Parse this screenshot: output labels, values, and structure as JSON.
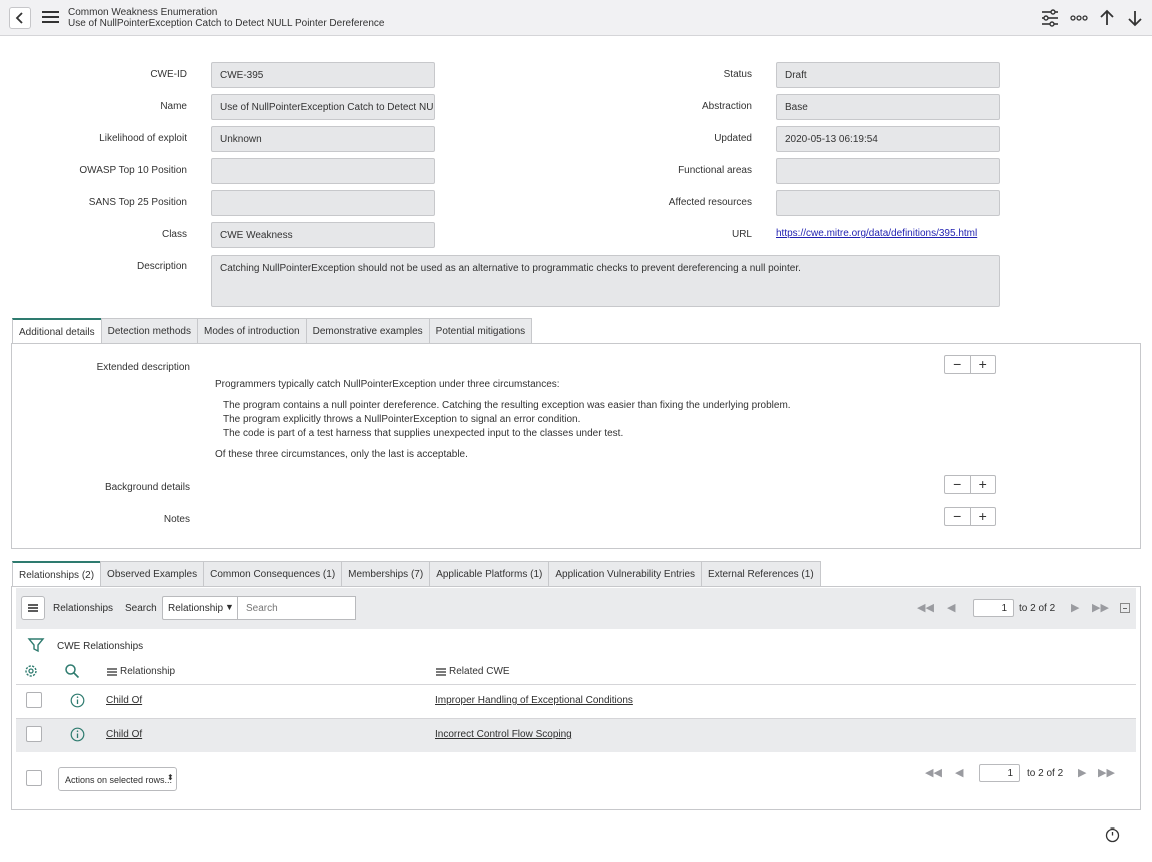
{
  "header": {
    "title": "Common Weakness Enumeration",
    "subtitle": "Use of NullPointerException Catch to Detect NULL Pointer Dereference"
  },
  "form": {
    "left": [
      {
        "label": "CWE-ID",
        "value": "CWE-395"
      },
      {
        "label": "Name",
        "value": "Use of NullPointerException Catch to Detect NULL Pointer Dereference"
      },
      {
        "label": "Likelihood of exploit",
        "value": "Unknown"
      },
      {
        "label": "OWASP Top 10 Position",
        "value": ""
      },
      {
        "label": "SANS Top 25 Position",
        "value": ""
      },
      {
        "label": "Class",
        "value": "CWE Weakness"
      }
    ],
    "right": [
      {
        "label": "Status",
        "value": "Draft"
      },
      {
        "label": "Abstraction",
        "value": "Base"
      },
      {
        "label": "Updated",
        "value": "2020-05-13 06:19:54"
      },
      {
        "label": "Functional areas",
        "value": ""
      },
      {
        "label": "Affected resources",
        "value": ""
      }
    ],
    "url_label": "URL",
    "url_value": "https://cwe.mitre.org/data/definitions/395.html",
    "description_label": "Description",
    "description_value": "Catching NullPointerException should not be used as an alternative to programmatic checks to prevent dereferencing a null pointer."
  },
  "detail_tabs": [
    "Additional details",
    "Detection methods",
    "Modes of introduction",
    "Demonstrative examples",
    "Potential mitigations"
  ],
  "additional": {
    "extended_label": "Extended description",
    "extended_intro": "Programmers typically catch NullPointerException under three circumstances:",
    "extended_items": [
      "The program contains a null pointer dereference. Catching the resulting exception was easier than fixing the underlying problem.",
      "The program explicitly throws a NullPointerException to signal an error condition.",
      "The code is part of a test harness that supplies unexpected input to the classes under test."
    ],
    "extended_outro": "Of these three circumstances, only the last is acceptable.",
    "background_label": "Background details",
    "notes_label": "Notes",
    "minus": "−",
    "plus": "+"
  },
  "related_tabs": [
    "Relationships (2)",
    "Observed Examples",
    "Common Consequences (1)",
    "Memberships (7)",
    "Applicable Platforms (1)",
    "Application Vulnerability Entries",
    "External References (1)"
  ],
  "list": {
    "title": "Relationships",
    "search_label": "Search",
    "search_field": "Relationship",
    "search_placeholder": "Search",
    "page": "1",
    "page_of": "to 2 of 2",
    "breadcrumb": "CWE Relationships",
    "columns": [
      "Relationship",
      "Related CWE"
    ],
    "rows": [
      {
        "relationship": "Child Of",
        "related": "Improper Handling of Exceptional Conditions"
      },
      {
        "relationship": "Child Of",
        "related": "Incorrect Control Flow Scoping"
      }
    ],
    "actions_label": "Actions on selected rows..."
  }
}
